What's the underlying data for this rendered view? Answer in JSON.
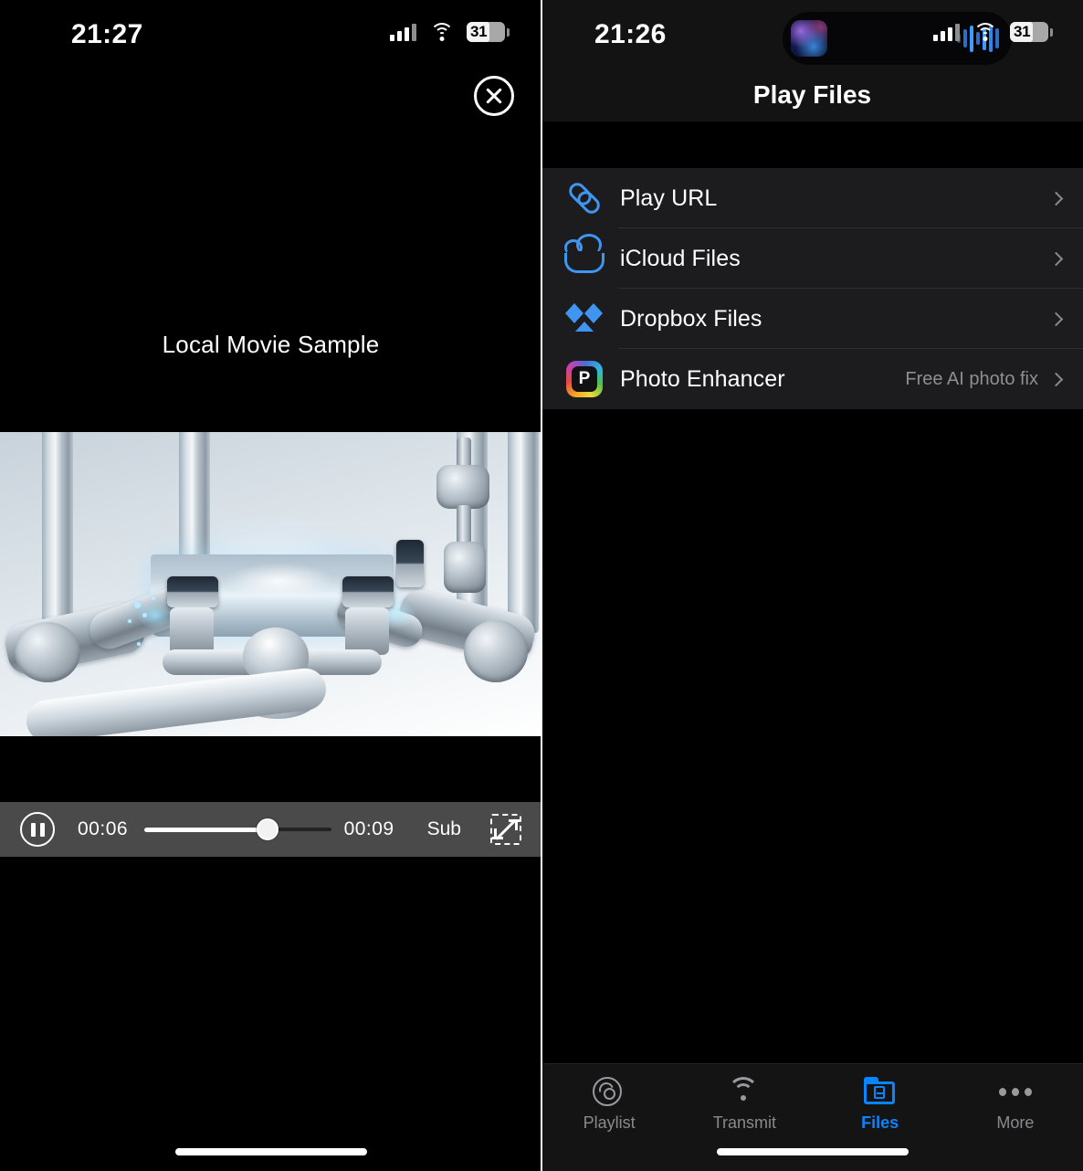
{
  "left_panel": {
    "status_bar": {
      "time": "21:27",
      "battery_level": "31",
      "cellular_icon": "cellular-bars-icon",
      "wifi_icon": "wifi-icon",
      "battery_icon": "battery-icon"
    },
    "close_button_icon": "close-circle-icon",
    "media_title": "Local Movie Sample",
    "video": {
      "description": "robotic-arms-assembly-video-frame"
    },
    "controls": {
      "pause_icon": "pause-icon",
      "current_time": "00:06",
      "duration": "00:09",
      "progress_percent": 66,
      "subtitles_label": "Sub",
      "expand_icon": "expand-fullscreen-icon"
    }
  },
  "right_panel": {
    "status_bar": {
      "time": "21:26",
      "battery_level": "31",
      "dynamic_island": {
        "artwork_icon": "album-artwork-thumbnail",
        "waveform_icon": "audio-waveform-icon"
      }
    },
    "header": {
      "title": "Play Files"
    },
    "list": [
      {
        "label": "Play URL",
        "icon": "link-icon",
        "value": ""
      },
      {
        "label": "iCloud Files",
        "icon": "cloud-icon",
        "value": ""
      },
      {
        "label": "Dropbox Files",
        "icon": "dropbox-icon",
        "value": ""
      },
      {
        "label": "Photo Enhancer",
        "icon": "photo-enhancer-icon",
        "value": "Free AI photo fix"
      }
    ],
    "tabs": [
      {
        "label": "Playlist",
        "icon": "disc-icon",
        "active": false
      },
      {
        "label": "Transmit",
        "icon": "broadcast-icon",
        "active": false
      },
      {
        "label": "Files",
        "icon": "folder-icon",
        "active": true
      },
      {
        "label": "More",
        "icon": "ellipsis-icon",
        "active": false
      }
    ]
  },
  "colors": {
    "accent": "#0a84ff",
    "icon_blue": "#3f96f0",
    "background": "#000000",
    "list_background": "#1c1c1e",
    "secondary_text": "#8e8e93",
    "controls_background": "#4a4a4a"
  }
}
